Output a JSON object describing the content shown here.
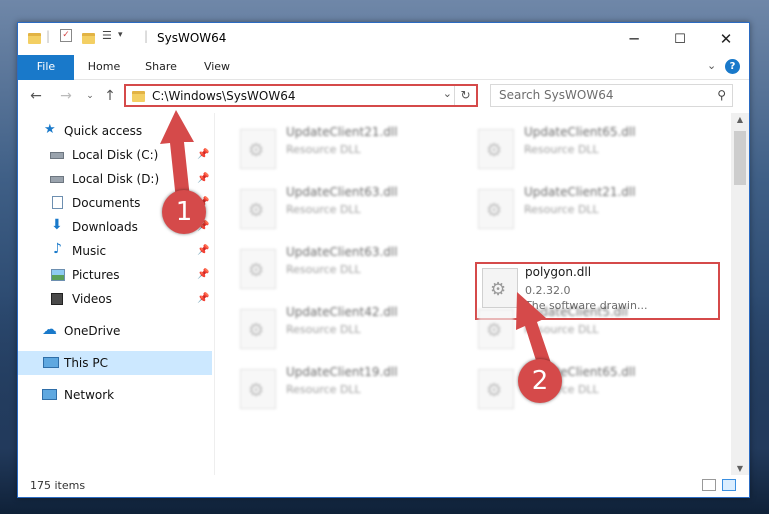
{
  "window": {
    "title": "SysWOW64",
    "controls": {
      "minimize": "─",
      "maximize": "☐",
      "close": "✕"
    }
  },
  "ribbon": {
    "tabs": [
      "File",
      "Home",
      "Share",
      "View"
    ],
    "help": "?"
  },
  "address": {
    "path": "C:\\Windows\\SysWOW64",
    "search_placeholder": "Search SysWOW64"
  },
  "sidebar": {
    "items": [
      {
        "label": "Quick access",
        "icon": "star-icon",
        "pinned": false
      },
      {
        "label": "Local Disk (C:)",
        "icon": "drive-icon",
        "pinned": true
      },
      {
        "label": "Local Disk (D:)",
        "icon": "drive-icon",
        "pinned": true
      },
      {
        "label": "Documents",
        "icon": "documents-icon",
        "pinned": true
      },
      {
        "label": "Downloads",
        "icon": "downloads-icon",
        "pinned": true
      },
      {
        "label": "Music",
        "icon": "music-icon",
        "pinned": true
      },
      {
        "label": "Pictures",
        "icon": "pictures-icon",
        "pinned": true
      },
      {
        "label": "Videos",
        "icon": "videos-icon",
        "pinned": true
      },
      {
        "label": "OneDrive",
        "icon": "onedrive-icon",
        "pinned": false
      },
      {
        "label": "This PC",
        "icon": "computer-icon",
        "pinned": false,
        "selected": true
      },
      {
        "label": "Network",
        "icon": "network-icon",
        "pinned": false
      }
    ]
  },
  "files": [
    {
      "name": "UpdateClient21.dll",
      "type": "Resource DLL"
    },
    {
      "name": "UpdateClient65.dll",
      "type": "Resource DLL"
    },
    {
      "name": "UpdateClient63.dll",
      "type": "Resource DLL"
    },
    {
      "name": "UpdateClient21.dll",
      "type": "Resource DLL"
    },
    {
      "name": "UpdateClient63.dll",
      "type": "Resource DLL"
    },
    {
      "name": "UpdateClient42.dll",
      "type": "Resource DLL"
    },
    {
      "name": "UpdateClient5.dll",
      "type": "Resource DLL"
    },
    {
      "name": "UpdateClient19.dll",
      "type": "Resource DLL"
    },
    {
      "name": "UpdateClient65.dll",
      "type": "Resource DLL"
    }
  ],
  "highlighted_file": {
    "name": "polygon.dll",
    "version": "0.2.32.0",
    "description": "The software drawin..."
  },
  "status": {
    "items_count": "175 items"
  },
  "annotations": {
    "step1": "1",
    "step2": "2",
    "color": "#d54a4a"
  }
}
